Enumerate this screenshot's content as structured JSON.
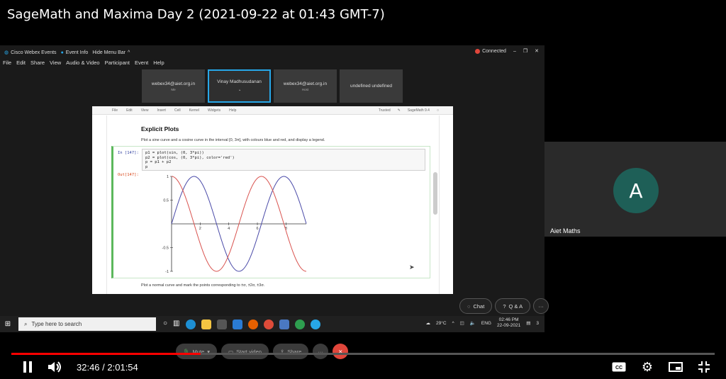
{
  "video": {
    "title": "SageMath and Maxima Day 2 (2021-09-22 at 01:43 GMT-7)"
  },
  "webex": {
    "app_name": "Cisco Webex Events",
    "event_info": "Event Info",
    "hide_menu": "Hide Menu Bar",
    "status": "Connected",
    "menu": [
      "File",
      "Edit",
      "Share",
      "View",
      "Audio & Video",
      "Participant",
      "Event",
      "Help"
    ],
    "tiles": [
      {
        "name": "webex34@aiet.org.in",
        "sub": "Me"
      },
      {
        "name": "Vinay Madhusudanan",
        "sub": ""
      },
      {
        "name": "webex34@aiet.org.in",
        "sub": "Host"
      },
      {
        "name": "undefined undefined",
        "sub": ""
      }
    ],
    "controls": {
      "mute": "Mute",
      "start_video": "Start video",
      "share": "Share",
      "chat": "Chat",
      "qa": "Q & A"
    },
    "participant": {
      "initial": "A",
      "name": "Aiet Maths"
    }
  },
  "notebook": {
    "menu": [
      "File",
      "Edit",
      "View",
      "Insert",
      "Cell",
      "Kernel",
      "Widgets",
      "Help"
    ],
    "trusted": "Trusted",
    "kernel": "SageMath 9.4",
    "heading": "Explicit Plots",
    "description": "Plot a sine curve and a cosine curve in the interval [0, 3π], with colours blue and red, and display a legend.",
    "in_prompt": "In [147]:",
    "code": "p1 = plot(sin, (0, 3*pi))\np2 = plot(cos, (0, 3*pi), color='red')\np = p1 + p2\np",
    "out_prompt": "Out[147]:",
    "footer": "Plot a normal curve and mark the points corresponding to ±σ, ±2σ, ±3σ."
  },
  "chart_data": {
    "type": "line",
    "xlim": [
      0,
      9.42
    ],
    "ylim": [
      -1,
      1
    ],
    "xticks": [
      "2",
      "4",
      "6",
      "8"
    ],
    "yticks": [
      "1",
      "0.5",
      "-0.5",
      "-1"
    ],
    "series": [
      {
        "function": "sin",
        "color": "#4a4aa8",
        "x_range": [
          0,
          9.42
        ]
      },
      {
        "function": "cos",
        "color": "#d9534f",
        "x_range": [
          0,
          9.42
        ]
      }
    ]
  },
  "taskbar": {
    "search_placeholder": "Type here to search",
    "weather": "29°C",
    "lang": "ENG",
    "time": "02:46 PM",
    "date": "22-09-2021",
    "notif": "3"
  },
  "player": {
    "current": "32:46",
    "duration": "2:01:54",
    "progress": 0.269,
    "separator": " / "
  },
  "colors": {
    "progress": "#ff0000",
    "webex_active": "#27a7e8",
    "end_call": "#e0463b",
    "avatar": "#1e5f57"
  }
}
